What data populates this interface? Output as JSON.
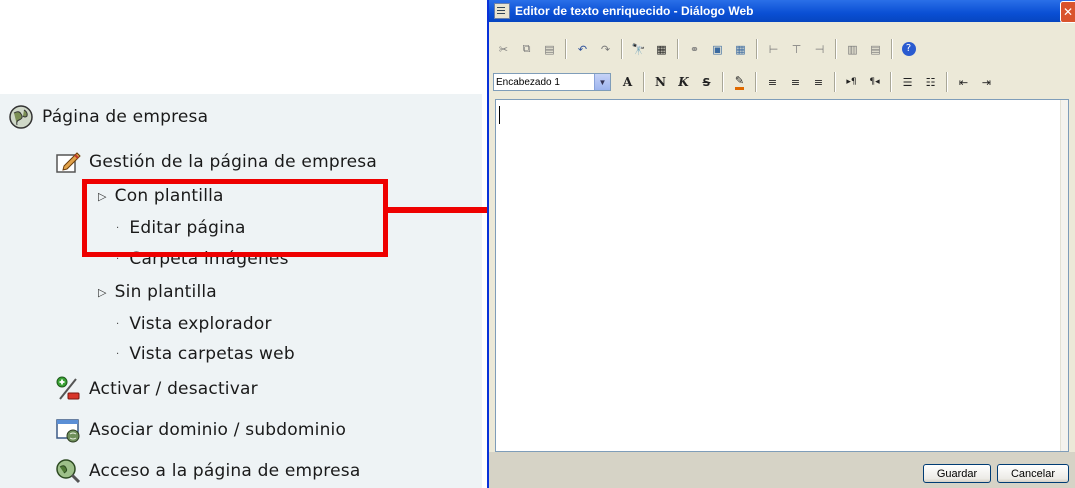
{
  "nav": {
    "company_page": "Página de empresa",
    "manage_company_page": "Gestión de la página de empresa",
    "with_template": "Con plantilla",
    "edit_page": "Editar página",
    "images_folder": "Carpeta imágenes",
    "without_template": "Sin plantilla",
    "explorer_view": "Vista explorador",
    "web_folders_view": "Vista carpetas web",
    "activate_deactivate": "Activar / desactivar",
    "associate_domain": "Asociar dominio / subdominio",
    "access_company_page": "Acceso a la página de empresa"
  },
  "dialog": {
    "title": "Editor de texto enriquecido - Diálogo Web",
    "close_glyph": "✕",
    "style_select": {
      "selected": "Encabezado 1"
    },
    "toolbar2": {
      "font_a": "A",
      "bold": "N",
      "italic": "K",
      "strike": "S"
    },
    "buttons": {
      "save": "Guardar",
      "cancel": "Cancelar"
    }
  },
  "colors": {
    "highlight": "#ee0000",
    "titlebar": "#0a4fd4",
    "nav_bg": "#eef3f5",
    "dialog_bg": "#ece9d8"
  }
}
